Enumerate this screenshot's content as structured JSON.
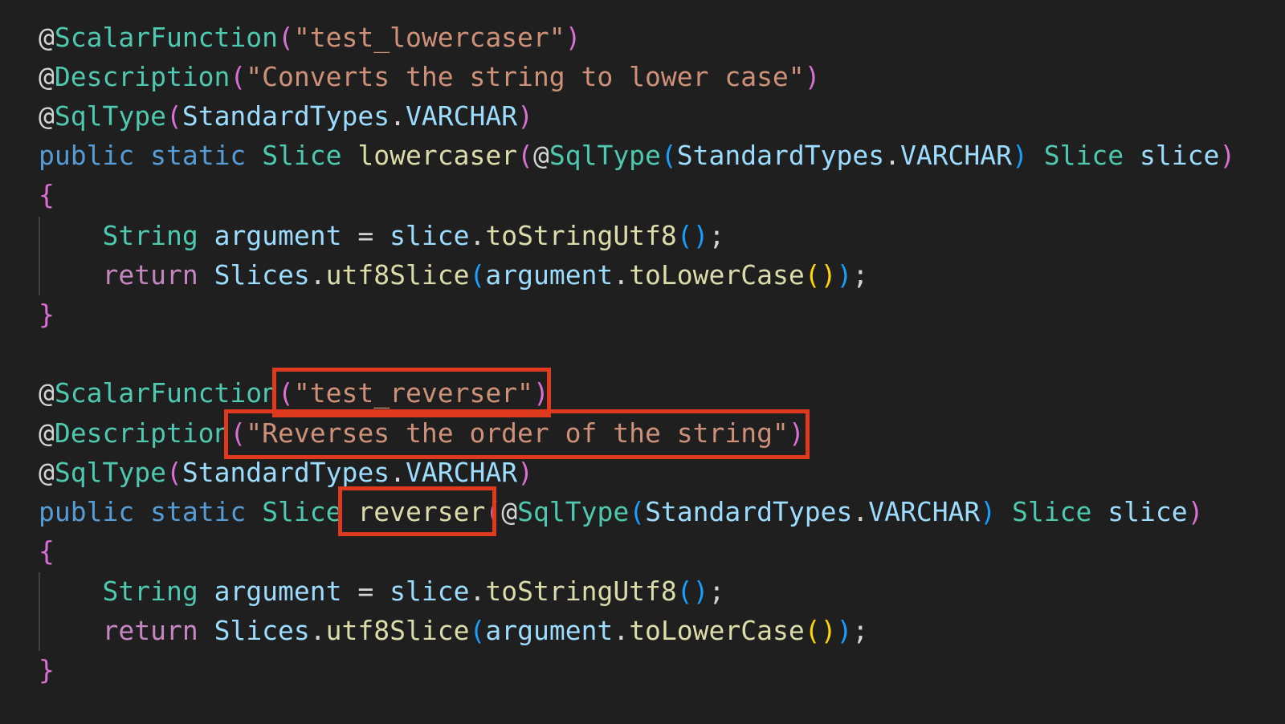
{
  "block1": {
    "ann1": "ScalarFunction",
    "name": "\"test_lowercaser\"",
    "ann2": "Description",
    "desc": "\"Converts the string to lower case\"",
    "ann3": "SqlType",
    "type_ref": "StandardTypes",
    "type_const": "VARCHAR",
    "kw_public": "public",
    "kw_static": "static",
    "ret_type": "Slice",
    "method": "lowercaser",
    "param_type": "Slice",
    "param_name": "slice",
    "local_type": "String",
    "local_name": "argument",
    "recv": "slice",
    "call1": "toStringUtf8",
    "kw_return": "return",
    "cls": "Slices",
    "call2": "utf8Slice",
    "arg": "argument",
    "call3": "toLowerCase"
  },
  "block2": {
    "ann1": "ScalarFunction",
    "name": "\"test_reverser\"",
    "ann2": "Description",
    "desc": "\"Reverses the order of the string\"",
    "ann3": "SqlType",
    "type_ref": "StandardTypes",
    "type_const": "VARCHAR",
    "kw_public": "public",
    "kw_static": "static",
    "ret_type": "Slice",
    "method": "reverser",
    "param_type": "Slice",
    "param_name": "slice",
    "local_type": "String",
    "local_name": "argument",
    "recv": "slice",
    "call1": "toStringUtf8",
    "kw_return": "return",
    "cls": "Slices",
    "call2": "utf8Slice",
    "arg": "argument",
    "call3": "toLowerCase"
  },
  "colors": {
    "background": "#1f1f1f",
    "highlight_box": "#e03a1e"
  }
}
